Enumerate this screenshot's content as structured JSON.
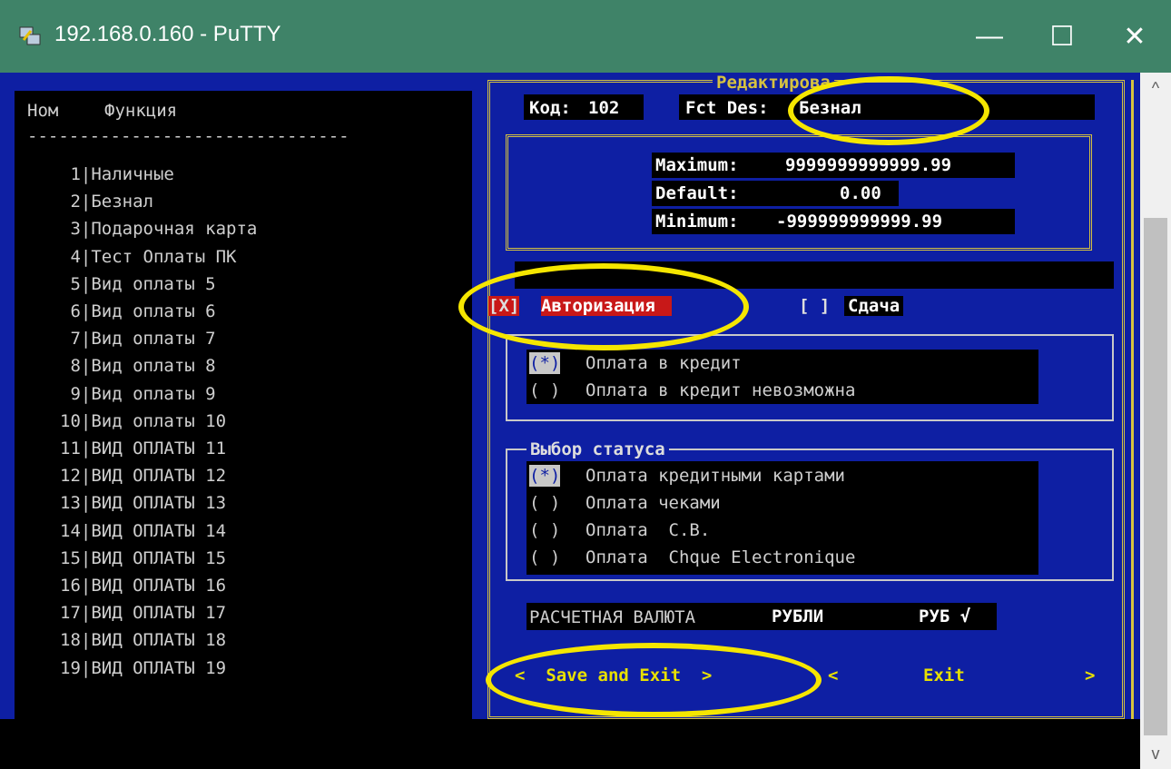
{
  "window": {
    "title": "192.168.0.160 - PuTTY",
    "minimize": "—",
    "maximize": "☐",
    "close": "✕"
  },
  "scrollbar": {
    "up": "^",
    "down": "v"
  },
  "list": {
    "header_num": "Ном",
    "header_fn": "Функция",
    "separator": "-------------------------------",
    "rows": [
      " 1|Наличные",
      " 2|Безнал",
      " 3|Подарочная карта",
      " 4|Тест Оплаты ПК",
      " 5|Вид оплаты 5",
      " 6|Вид оплаты 6",
      " 7|Вид оплаты 7",
      " 8|Вид оплаты 8",
      " 9|Вид оплаты 9",
      "10|Вид оплаты 10",
      "11|ВИД ОПЛАТЫ 11",
      "12|ВИД ОПЛАТЫ 12",
      "13|ВИД ОПЛАТЫ 13",
      "14|ВИД ОПЛАТЫ 14",
      "15|ВИД ОПЛАТЫ 15",
      "16|ВИД ОПЛАТЫ 16",
      "17|ВИД ОПЛАТЫ 17",
      "18|ВИД ОПЛАТЫ 18",
      "19|ВИД ОПЛАТЫ 19"
    ]
  },
  "panel": {
    "title": "Редактирова",
    "code_label": "Код:",
    "code_value": "102",
    "fct_label": "Fct Des:",
    "fct_value": "Безнал",
    "max_label": "Maximum:",
    "max_value": "9999999999999.99",
    "default_label": "Default:",
    "default_value": "0.00",
    "min_label": "Minimum:",
    "min_value": "-999999999999.99",
    "auth_check": "[X]",
    "auth_label": "Авторизация",
    "change_check": "[ ]",
    "change_label": "Сдача",
    "credit_options": [
      {
        "mark": "(*)",
        "label": "Оплата в кредит"
      },
      {
        "mark": "( )",
        "label": "Оплата в кредит невозможна"
      }
    ],
    "status_title": "Выбор статуса",
    "status_options": [
      {
        "mark": "(*)",
        "label": "Оплата кредитными картами"
      },
      {
        "mark": "( )",
        "label": "Оплата чеками"
      },
      {
        "mark": "( )",
        "label": "Оплата  С.В."
      },
      {
        "mark": "( )",
        "label": "Оплата  Chque Electronique"
      }
    ],
    "currency_label": "РАСЧЕТНАЯ ВАЛЮТА",
    "currency_value": "РУБЛИ",
    "currency_code": "РУБ √",
    "save_exit": "<  Save and Exit  >",
    "exit_left": "<",
    "exit_label": "Exit",
    "exit_right": ">"
  },
  "colors": {
    "highlight_ring": "#f5e600",
    "terminal_bg": "#0e1fa3",
    "border": "#d6c240"
  }
}
